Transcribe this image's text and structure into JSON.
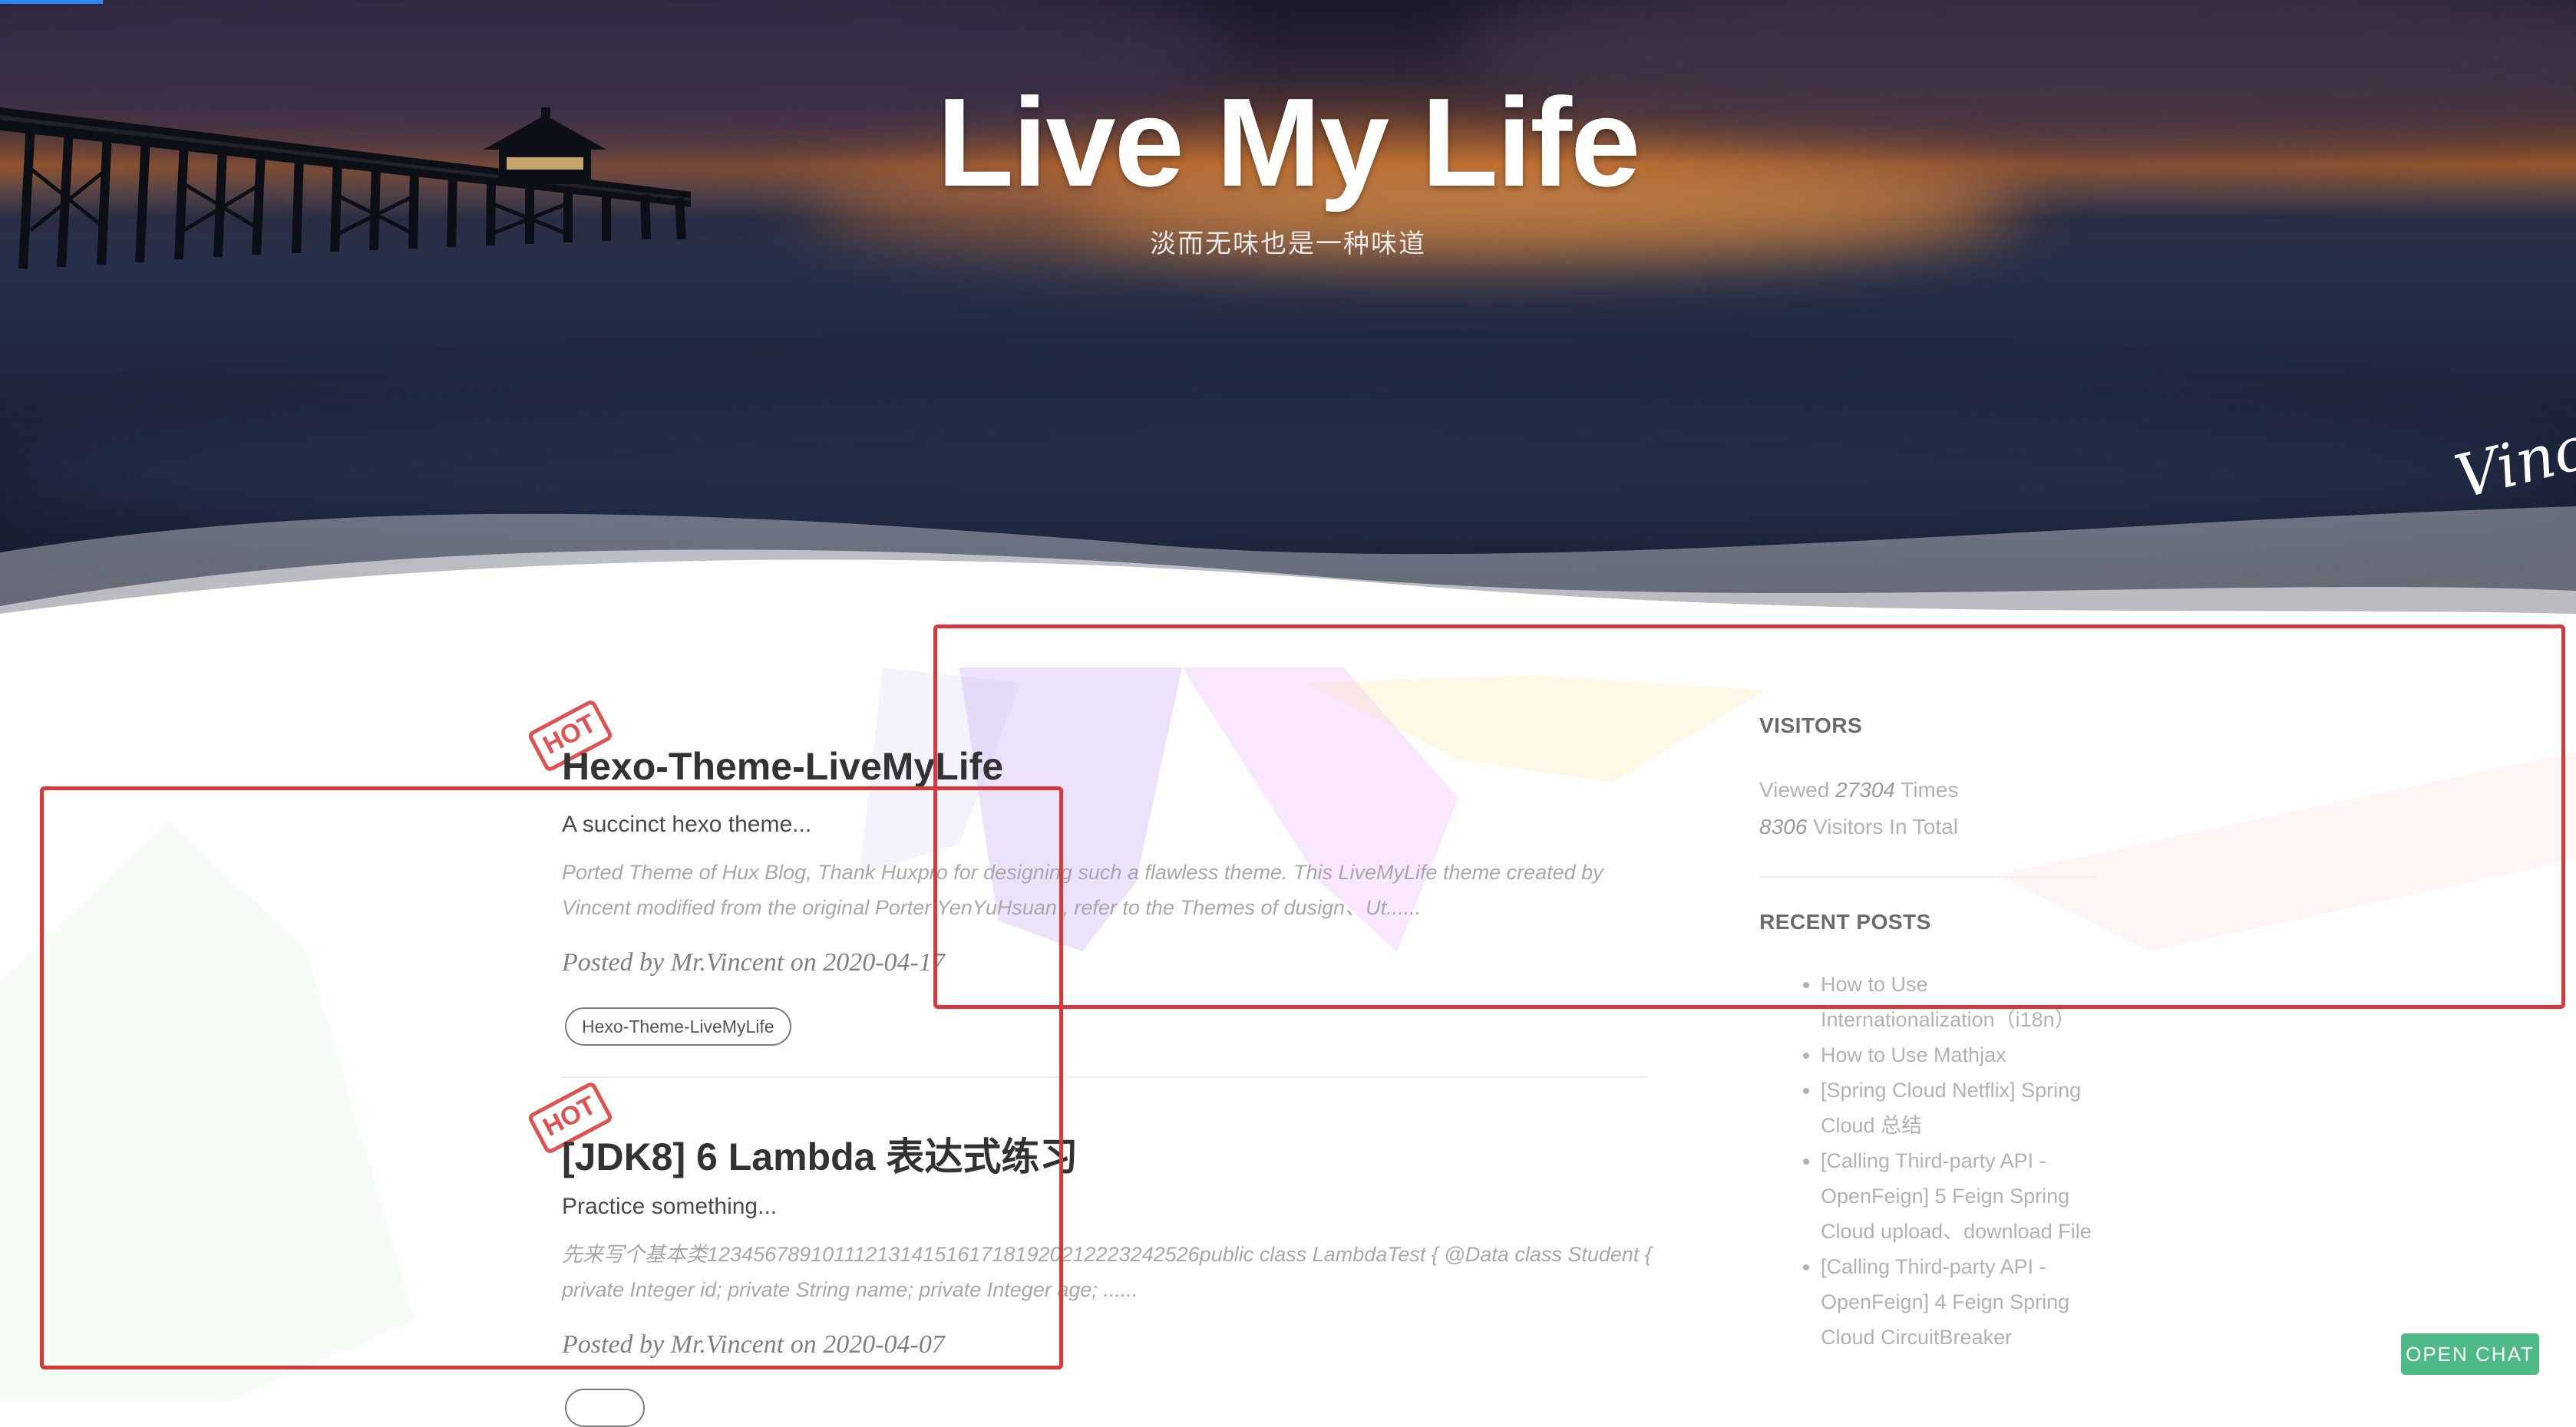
{
  "header": {
    "title": "Live My Life",
    "subtitle": "淡而无味也是一种味道",
    "signature": "Vincent."
  },
  "posts": [
    {
      "hot_label": "HOT",
      "title": "Hexo-Theme-LiveMyLife",
      "subtitle": "A succinct hexo theme...",
      "excerpt": "Ported Theme of Hux Blog, Thank Huxpro for designing such a flawless theme. This LiveMyLife theme created by Vincent modified from the original Porter YenYuHsuan , refer to the Themes of dusign、Ut......",
      "meta": "Posted by Mr.Vincent on 2020-04-17",
      "tag": "Hexo-Theme-LiveMyLife"
    },
    {
      "hot_label": "HOT",
      "title": "[JDK8] 6 Lambda 表达式练习",
      "subtitle": "Practice something...",
      "excerpt": "先来写个基本类1234567891011121314151617181920212223242526public class LambdaTest { @Data class Student { private Integer id; private String name; private Integer age; ......",
      "meta": "Posted by Mr.Vincent on 2020-04-07"
    }
  ],
  "sidebar": {
    "visitors": {
      "heading": "VISITORS",
      "viewed_prefix": "Viewed",
      "viewed_count": "27304",
      "viewed_suffix": "Times",
      "visitors_count": "8306",
      "visitors_suffix": "Visitors In Total"
    },
    "recent": {
      "heading": "RECENT POSTS",
      "items": [
        "How to Use Internationalization（i18n）",
        "How to Use Mathjax",
        "[Spring Cloud Netflix] Spring Cloud 总结",
        "[Calling Third-party API - OpenFeign] 5 Feign Spring Cloud upload、download File",
        "[Calling Third-party API - OpenFeign] 4 Feign Spring Cloud CircuitBreaker"
      ]
    }
  },
  "chat": {
    "label": "OPEN CHAT"
  },
  "icons": {
    "theme_toggle": "moon-icon"
  },
  "colors": {
    "accent": "#2f86f6",
    "hot": "#e0514f",
    "chat": "#4dba87",
    "annotation": "#d9383a"
  }
}
